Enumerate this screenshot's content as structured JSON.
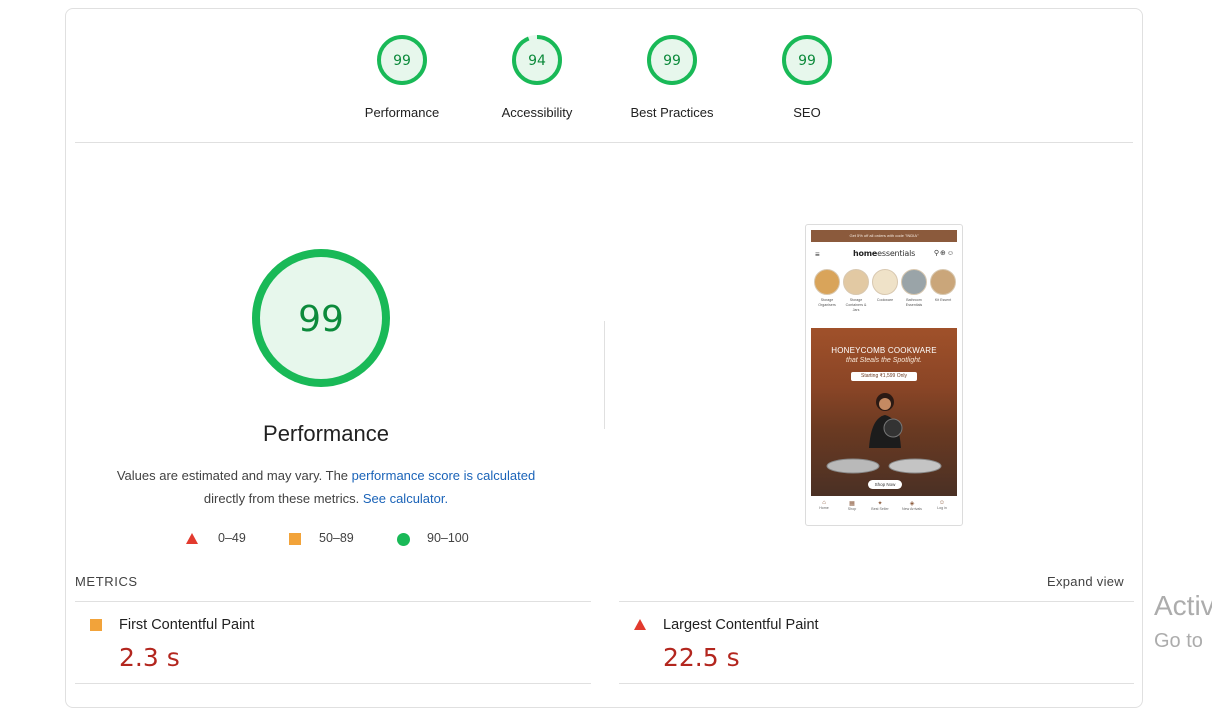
{
  "colors": {
    "pass": "#0c8a3b",
    "pass_ring": "#19b957",
    "average": "#f2a33a",
    "fail": "#e23a2e",
    "fail_value": "#b3261e",
    "link": "#1a63b8"
  },
  "gauges": [
    {
      "score": "99",
      "label": "Performance"
    },
    {
      "score": "94",
      "label": "Accessibility"
    },
    {
      "score": "99",
      "label": "Best Practices"
    },
    {
      "score": "99",
      "label": "SEO"
    }
  ],
  "performance": {
    "score": "99",
    "title": "Performance",
    "desc_prefix": "Values are estimated and may vary. The ",
    "desc_link": "performance score is calculated",
    "desc_middle": " directly from these metrics. ",
    "calc_link": "See calculator.",
    "legend": [
      {
        "icon": "triangle-icon",
        "range": "0–49"
      },
      {
        "icon": "square-icon",
        "range": "50–89"
      },
      {
        "icon": "circle-icon",
        "range": "90–100"
      }
    ]
  },
  "screenshot": {
    "topbar": "Get 5% off all orders with code \"INDIA\"",
    "logo_bold": "home",
    "logo_rest": "essentials",
    "categories": [
      "Storage Organisers",
      "Storage Containers & Jars",
      "Cookware",
      "Bathroom Essentials",
      "Kit Essent"
    ],
    "banner_title": "HONEYCOMB COOKWARE",
    "banner_sub": "that Steals the Spotlight.",
    "banner_price": "Starting ₹1,599 Only",
    "shop_now": "Shop Now",
    "nav": [
      "Home",
      "Shop",
      "Best Seller",
      "New Arrivals",
      "Log in"
    ]
  },
  "metrics": {
    "title": "METRICS",
    "expand": "Expand view",
    "items": [
      {
        "name": "First Contentful Paint",
        "value": "2.3 s",
        "rating": "average"
      },
      {
        "name": "Largest Contentful Paint",
        "value": "22.5 s",
        "rating": "fail"
      }
    ]
  },
  "watermark": {
    "line1": "Activ",
    "line2": "Go to"
  }
}
